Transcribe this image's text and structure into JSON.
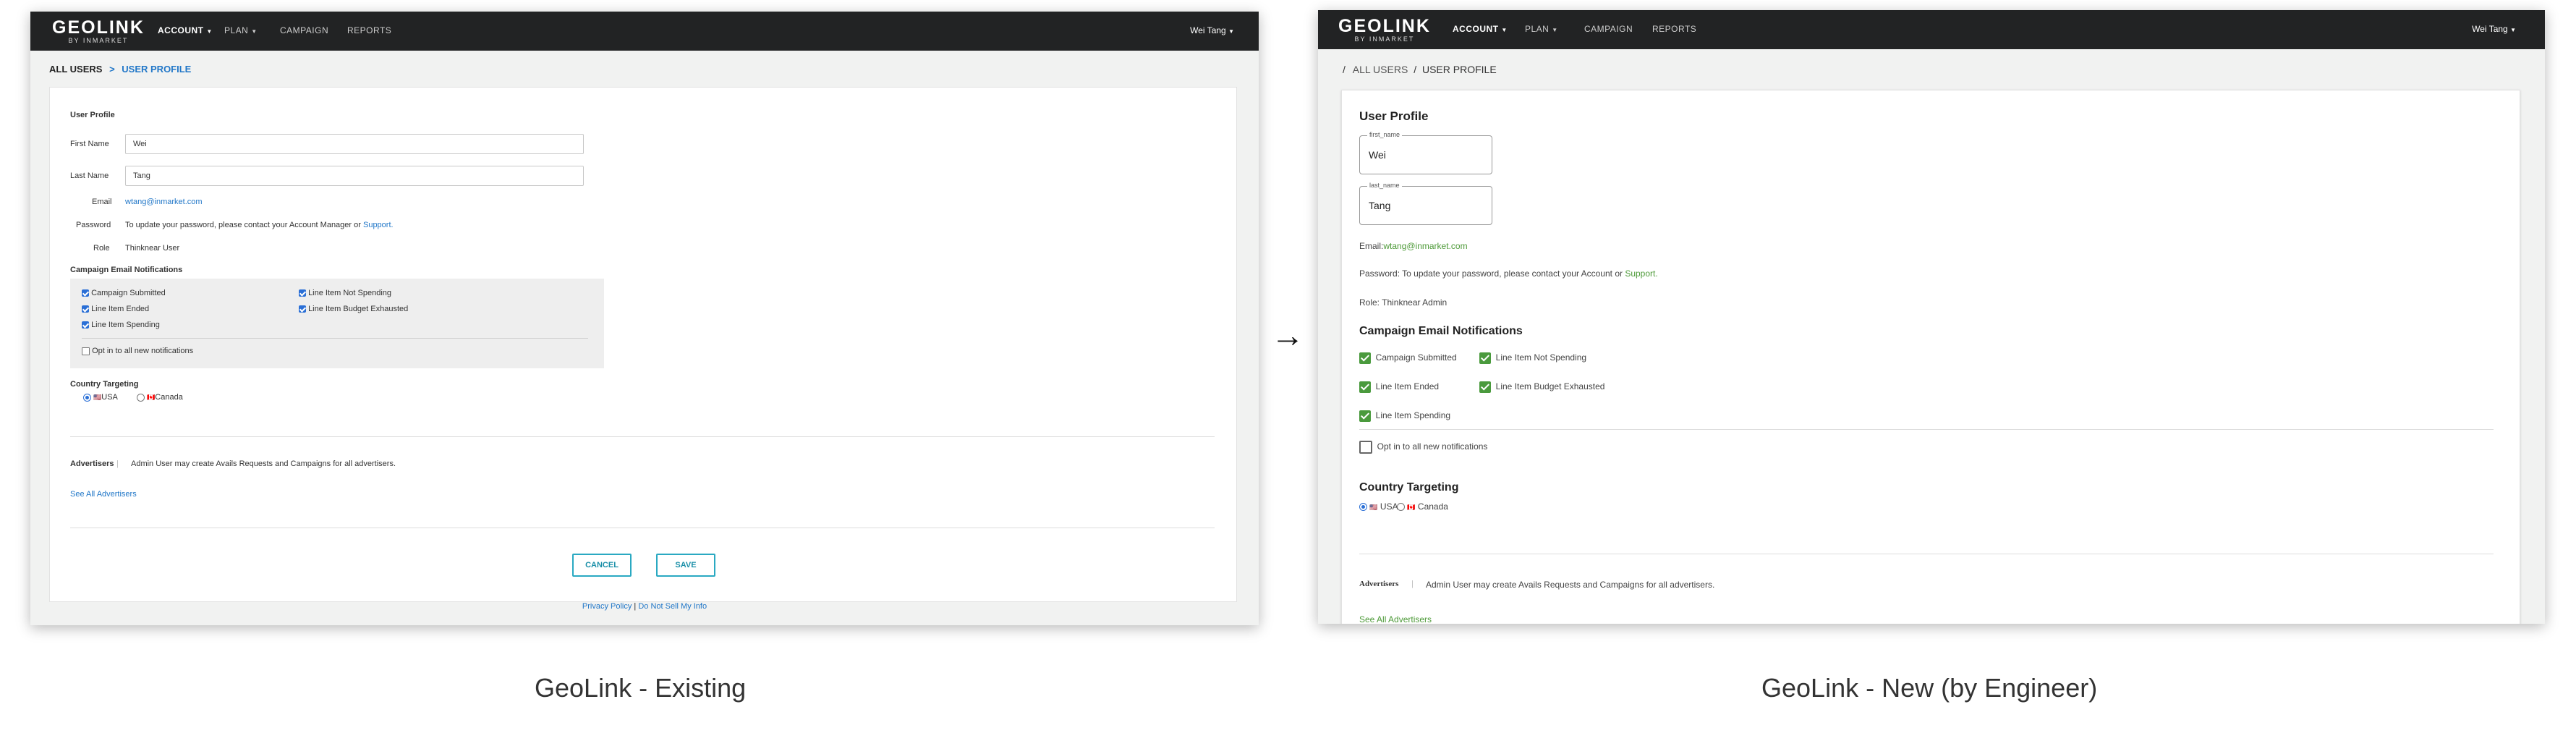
{
  "left": {
    "logo": {
      "name": "GEOLINK",
      "sub": "BY INMARKET"
    },
    "nav": [
      "ACCOUNT",
      "PLAN",
      "CAMPAIGN",
      "REPORTS"
    ],
    "user": "Wei Tang",
    "breadcrumb": {
      "root": "ALL USERS",
      "sep": ">",
      "current": "USER PROFILE"
    },
    "section_title": "User Profile",
    "first_name_label": "First Name",
    "first_name_value": "Wei",
    "last_name_label": "Last Name",
    "last_name_value": "Tang",
    "email_label": "Email",
    "email_value": "wtang@inmarket.com",
    "password_label": "Password",
    "password_text": "To update your password, please contact your Account Manager or",
    "password_link": "Support.",
    "role_label": "Role",
    "role_value": "Thinknear User",
    "notif_title": "Campaign Email Notifications",
    "notif_col1": [
      "Campaign Submitted",
      "Line Item Ended",
      "Line Item Spending"
    ],
    "notif_col2": [
      "Line Item Not Spending",
      "Line Item Budget Exhausted"
    ],
    "opt_in": "Opt in to all new notifications",
    "country_title": "Country Targeting",
    "country_usa": "USA",
    "country_canada": "Canada",
    "advertisers_label": "Advertisers",
    "advertisers_text": "Admin User may create Avails Requests and Campaigns for all advertisers.",
    "see_all": "See All Advertisers",
    "cancel": "CANCEL",
    "save": "SAVE",
    "footer_privacy": "Privacy Policy",
    "footer_sep": "|",
    "footer_donotsell": "Do Not Sell My Info"
  },
  "right": {
    "logo": {
      "name": "GEOLINK",
      "sub": "BY INMARKET"
    },
    "nav": [
      "ACCOUNT",
      "PLAN",
      "CAMPAIGN",
      "REPORTS"
    ],
    "user": "Wei Tang",
    "breadcrumb": {
      "sep": "/",
      "root": "ALL USERS",
      "current": "USER PROFILE"
    },
    "section_title": "User Profile",
    "first_name_label": "first_name",
    "first_name_value": "Wei",
    "last_name_label": "last_name",
    "last_name_value": "Tang",
    "email_label": "Email:",
    "email_value": "wtang@inmarket.com",
    "password_text": "Password: To update your password, please contact your Account or",
    "password_link": "Support.",
    "role_text": "Role: Thinknear Admin",
    "notif_title": "Campaign Email Notifications",
    "notif_col1": [
      "Campaign Submitted",
      "Line Item Ended",
      "Line Item Spending"
    ],
    "notif_col2": [
      "Line Item Not Spending",
      "Line Item Budget Exhausted"
    ],
    "opt_in": "Opt in to all new notifications",
    "country_title": "Country Targeting",
    "country_usa": "USA",
    "country_canada": "Canada",
    "advertisers_label": "Advertisers",
    "advertisers_text": "Admin User may create Avails Requests and Campaigns for all advertisers.",
    "see_all": "See All Advertisers"
  },
  "arrow": "→",
  "captions": {
    "left": "GeoLink - Existing",
    "right": "GeoLink - New (by Engineer)"
  }
}
